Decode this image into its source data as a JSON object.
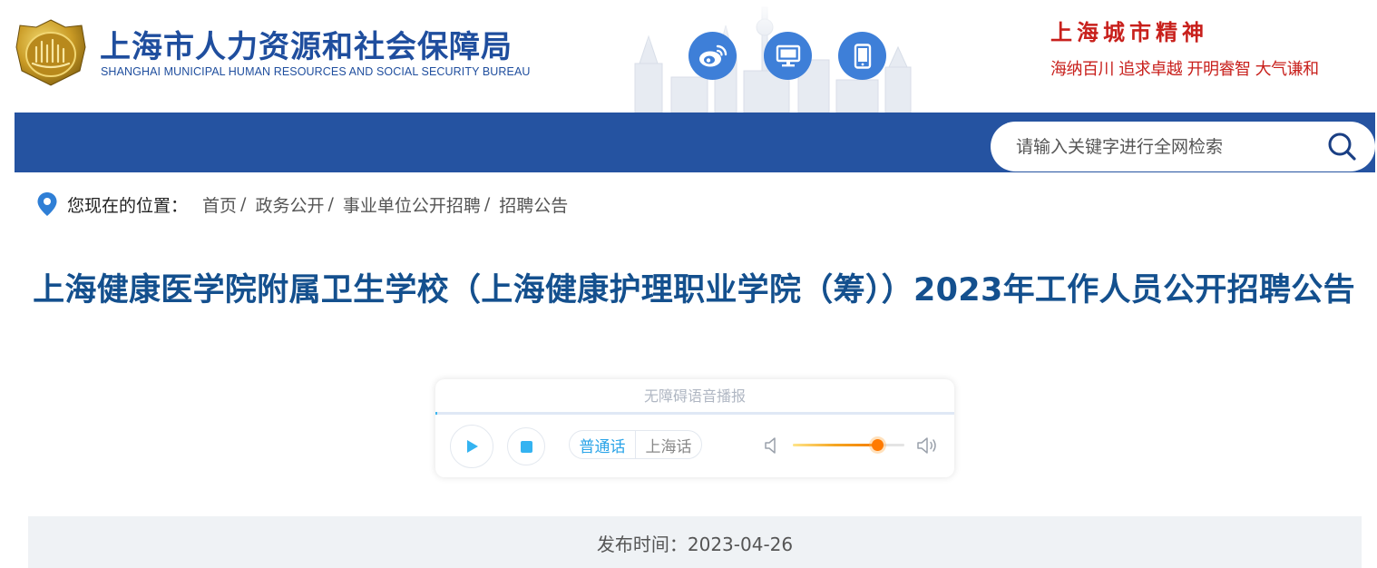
{
  "header": {
    "title_cn": "上海市人力资源和社会保障局",
    "title_en": "SHANGHAI MUNICIPAL HUMAN RESOURCES AND SOCIAL SECURITY BUREAU",
    "social_icons": [
      "weibo-icon",
      "desktop-icon",
      "mobile-icon"
    ],
    "city_spirit": {
      "title": "上海城市精神",
      "slogan": "海纳百川 追求卓越 开明睿智 大气谦和"
    }
  },
  "search": {
    "placeholder": "请输入关键字进行全网检索"
  },
  "breadcrumb": {
    "label": "您现在的位置：",
    "items": [
      "首页",
      "政务公开",
      "事业单位公开招聘",
      "招聘公告"
    ],
    "separator": "/"
  },
  "article": {
    "title": "上海健康医学院附属卫生学校（上海健康护理职业学院（筹））2023年工作人员公开招聘公告",
    "publish_time": "发布时间：2023-04-26"
  },
  "player": {
    "title": "无障碍语音播报",
    "languages": [
      "普通话",
      "上海话"
    ],
    "selected_language": "普通话",
    "progress": 0.0,
    "volume": 0.76
  },
  "colors": {
    "brand_blue": "#2553a1",
    "title_blue": "#14508e",
    "spirit_red": "#c8201c",
    "player_accent": "#34b3f1",
    "volume_knob": "#ff7a00"
  }
}
